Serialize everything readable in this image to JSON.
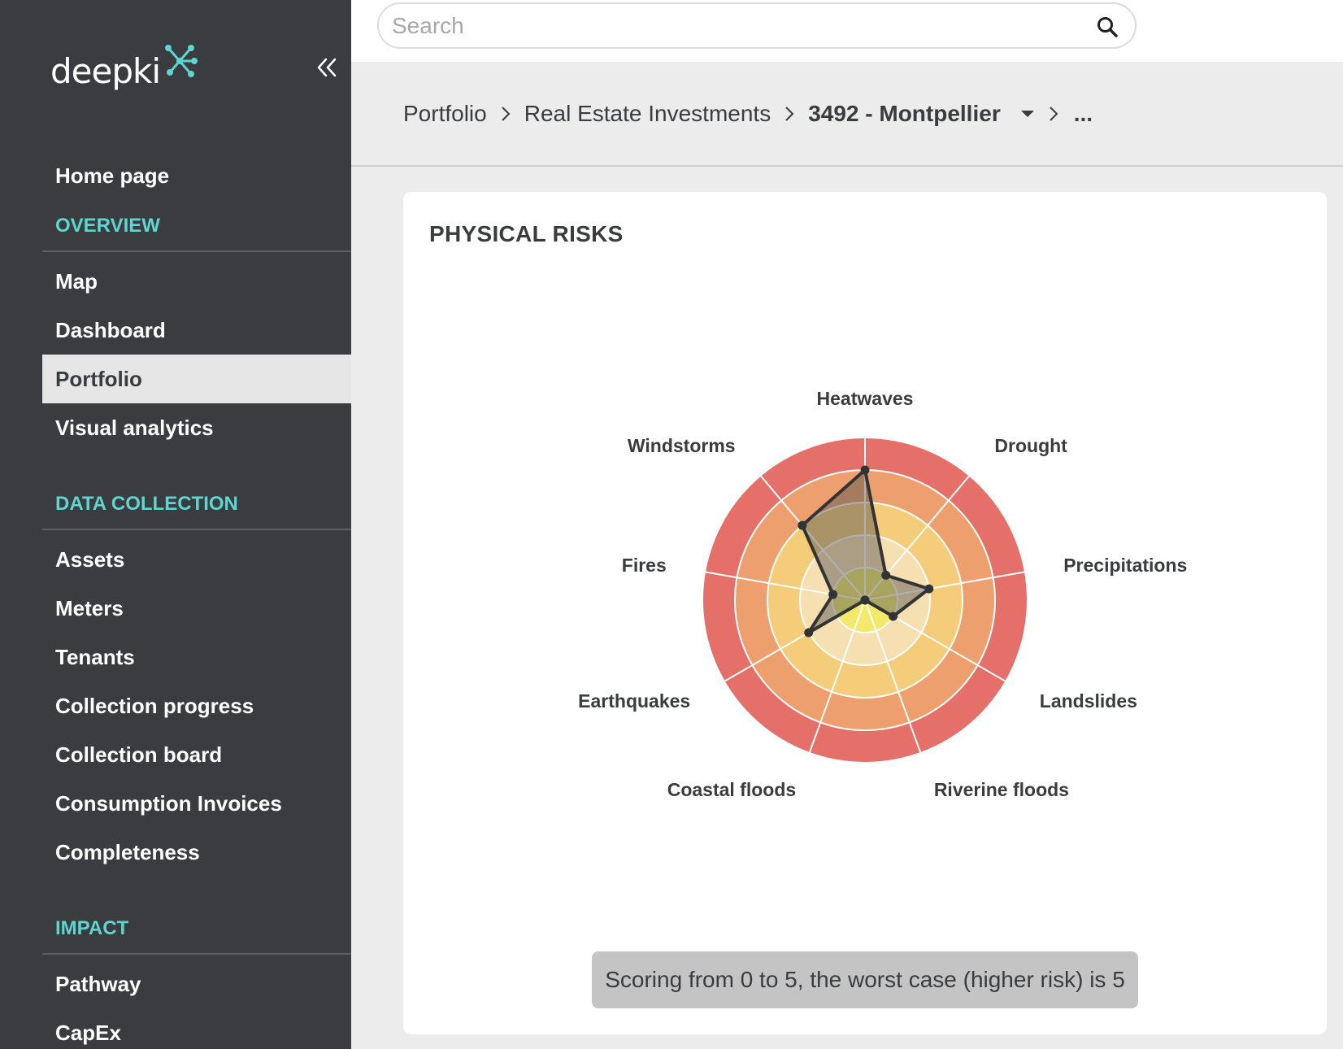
{
  "app": {
    "logo_text": "deepki"
  },
  "sidebar": {
    "items": [
      {
        "label": "Home page",
        "type": "item"
      },
      {
        "label": "OVERVIEW",
        "type": "section"
      },
      {
        "label": "Map",
        "type": "item"
      },
      {
        "label": "Dashboard",
        "type": "item"
      },
      {
        "label": "Portfolio",
        "type": "item",
        "active": true
      },
      {
        "label": "Visual analytics",
        "type": "item"
      },
      {
        "label": "",
        "type": "spacer"
      },
      {
        "label": "DATA COLLECTION",
        "type": "section"
      },
      {
        "label": "Assets",
        "type": "item"
      },
      {
        "label": "Meters",
        "type": "item"
      },
      {
        "label": "Tenants",
        "type": "item"
      },
      {
        "label": "Collection progress",
        "type": "item"
      },
      {
        "label": "Collection board",
        "type": "item"
      },
      {
        "label": "Consumption Invoices",
        "type": "item"
      },
      {
        "label": "Completeness",
        "type": "item"
      },
      {
        "label": "",
        "type": "spacer"
      },
      {
        "label": "IMPACT",
        "type": "section"
      },
      {
        "label": "Pathway",
        "type": "item"
      },
      {
        "label": "CapEx",
        "type": "item"
      }
    ]
  },
  "search": {
    "placeholder": "Search",
    "value": ""
  },
  "breadcrumb": {
    "portfolio": "Portfolio",
    "fund": "Real Estate Investments",
    "asset": "3492 - Montpellier",
    "more": "..."
  },
  "card": {
    "title": "PHYSICAL RISKS",
    "note": "Scoring from 0 to 5, the worst case (higher risk) is 5"
  },
  "colors": {
    "sidebar_bg": "#3a3c3f",
    "section_accent": "#5fd5cf",
    "ring_colors": [
      "#f3e96b",
      "#f6dfb0",
      "#f5cd7a",
      "#eda06e",
      "#e5706a"
    ]
  },
  "chart_data": {
    "type": "radar",
    "axes": [
      "Heatwaves",
      "Drought",
      "Precipitations",
      "Landslides",
      "Riverine floods",
      "Coastal floods",
      "Earthquakes",
      "Fires",
      "Windstorms"
    ],
    "values": [
      4,
      1,
      2,
      1,
      0,
      0,
      2,
      1,
      3
    ],
    "rmax": 5
  }
}
